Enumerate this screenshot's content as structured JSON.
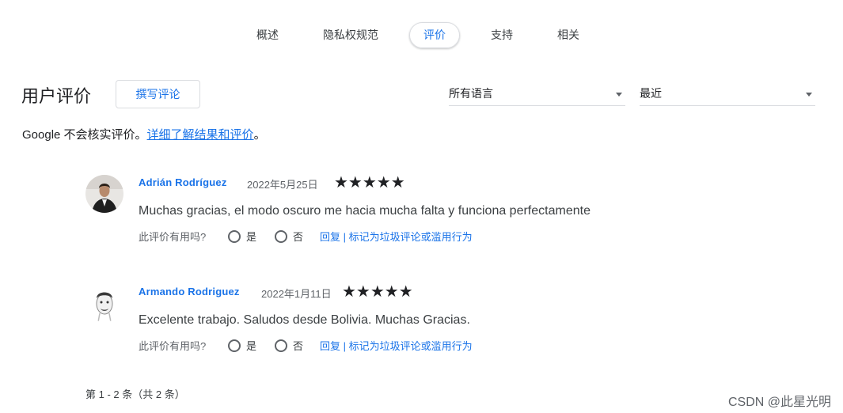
{
  "tabs": [
    {
      "label": "概述"
    },
    {
      "label": "隐私权规范"
    },
    {
      "label": "评价"
    },
    {
      "label": "支持"
    },
    {
      "label": "相关"
    }
  ],
  "header": {
    "title": "用户评价",
    "write_button": "撰写评论"
  },
  "filters": {
    "language": "所有语言",
    "sort": "最近"
  },
  "disclaimer": {
    "text": "Google 不会核实评价。",
    "link": "详细了解结果和评价",
    "suffix": "。"
  },
  "reviews": [
    {
      "author": "Adrián Rodríguez",
      "date": "2022年5月25日",
      "rating": 5,
      "stars": "★★★★★",
      "text": "Muchas gracias, el modo oscuro me hacia mucha falta y funciona perfectamente",
      "helpful_prompt": "此评价有用吗?",
      "yes": "是",
      "no": "否",
      "reply": "回复",
      "separator": "|",
      "report": "标记为垃圾评论或滥用行为"
    },
    {
      "author": "Armando Rodriguez",
      "date": "2022年1月11日",
      "rating": 5,
      "stars": "★★★★★",
      "text": "Excelente trabajo. Saludos desde Bolivia. Muchas Gracias.",
      "helpful_prompt": "此评价有用吗?",
      "yes": "是",
      "no": "否",
      "reply": "回复",
      "separator": "|",
      "report": "标记为垃圾评论或滥用行为"
    }
  ],
  "pagination": "第 1 - 2 条（共 2 条）",
  "watermark": "CSDN @此星光明",
  "colors": {
    "accent": "#1a73e8",
    "text": "#3c4043",
    "muted": "#5f6368",
    "border": "#dadce0"
  }
}
